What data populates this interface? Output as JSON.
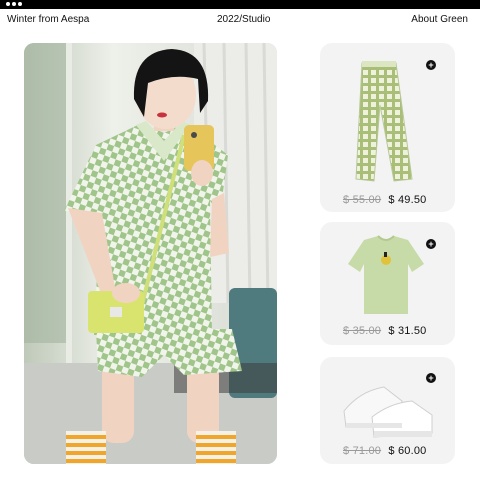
{
  "window": {
    "controls": [
      "dot",
      "dot",
      "dot"
    ]
  },
  "nav": {
    "left_label": "Winter from Aespa",
    "center_label": "2022/Studio",
    "right_label": "About Green"
  },
  "hero": {
    "icon": "photo-model-green-outfit"
  },
  "products": [
    {
      "item_icon": "checkered-pants-icon",
      "old_price": "$ 55.00",
      "new_price": "$ 49.50",
      "add_icon": "plus-icon"
    },
    {
      "item_icon": "green-tshirt-icon",
      "old_price": "$ 35.00",
      "new_price": "$ 31.50",
      "add_icon": "plus-icon"
    },
    {
      "item_icon": "white-sneakers-icon",
      "old_price": "$ 71.00",
      "new_price": "$ 60.00",
      "add_icon": "plus-icon"
    }
  ],
  "colors": {
    "accent_green": "#c7dba8",
    "card_bg": "#f3f3f3",
    "text": "#111111",
    "strike_price": "#9a9a9a"
  }
}
